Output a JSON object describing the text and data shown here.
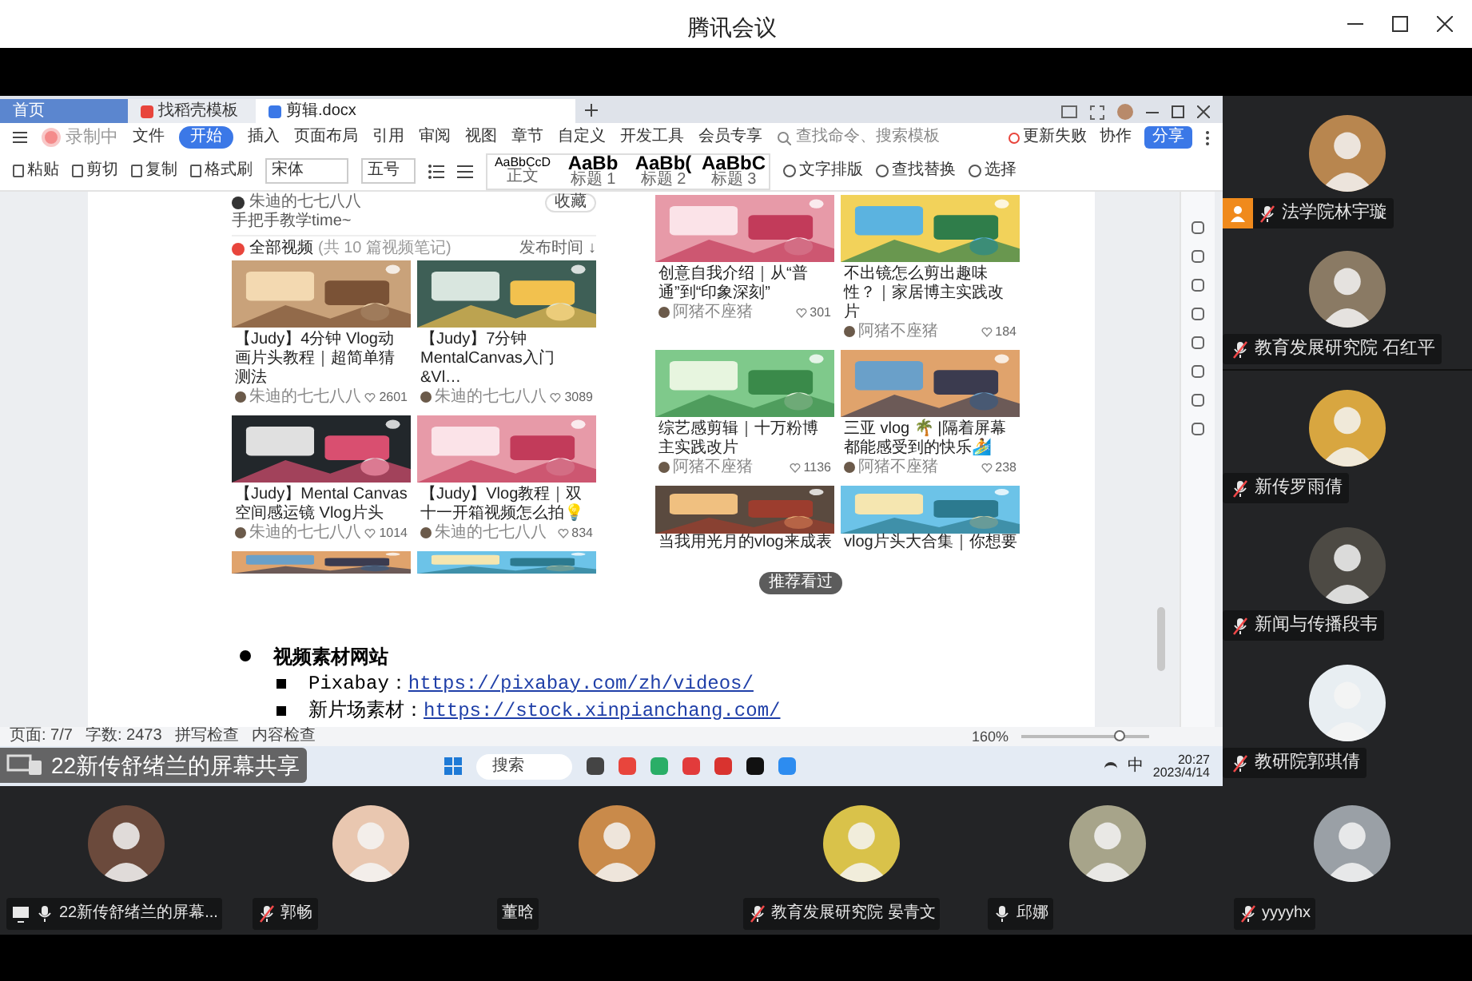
{
  "window": {
    "title": "腾讯会议"
  },
  "recording": {
    "label": "录制中"
  },
  "share": {
    "tabs": [
      {
        "label": "首页",
        "selected": false,
        "kind": "home"
      },
      {
        "label": "找稻壳模板",
        "selected": false,
        "kind": "template"
      },
      {
        "label": "剪辑.docx",
        "selected": true,
        "kind": "doc"
      }
    ],
    "menu": [
      {
        "label": "文件",
        "selected": false
      },
      {
        "label": "开始",
        "selected": true
      },
      {
        "label": "插入",
        "selected": false
      },
      {
        "label": "页面布局",
        "selected": false
      },
      {
        "label": "引用",
        "selected": false
      },
      {
        "label": "审阅",
        "selected": false
      },
      {
        "label": "视图",
        "selected": false
      },
      {
        "label": "章节",
        "selected": false
      },
      {
        "label": "自定义",
        "selected": false
      },
      {
        "label": "开发工具",
        "selected": false
      },
      {
        "label": "会员专享",
        "selected": false
      }
    ],
    "command_search": {
      "placeholder": "查找命令、搜索模板"
    },
    "sync_status": "更新失败",
    "collab": "协作",
    "share_button": "分享",
    "ribbon": {
      "clipboard": [
        "粘贴",
        "剪切",
        "复制",
        "格式刷"
      ],
      "font": "宋体",
      "size": "五号",
      "styles": [
        {
          "sample": "AaBbCcD",
          "label": "正文"
        },
        {
          "sample": "AaBb",
          "label": "标题 1"
        },
        {
          "sample": "AaBb(",
          "label": "标题 2"
        },
        {
          "sample": "AaBbC",
          "label": "标题 3"
        }
      ],
      "tools": [
        "文字排版",
        "查找替换",
        "选择"
      ]
    },
    "document": {
      "author": "朱迪的七七八八",
      "save_button": "收藏",
      "intro": "手把手教学time~",
      "section": {
        "title": "全部视频",
        "count": "(共 10 篇视频笔记)",
        "sort": "发布时间 ↓"
      },
      "left_cards": [
        {
          "title": "【Judy】4分钟 Vlog动画片头教程｜超简单猜测法",
          "author": "朱迪的七七八八",
          "likes": "2601"
        },
        {
          "title": "【Judy】7分钟 MentalCanvas入门&Vl…",
          "author": "朱迪的七七八八",
          "likes": "3089"
        },
        {
          "title": "【Judy】Mental Canvas 空间感运镜 Vlog片头",
          "author": "朱迪的七七八八",
          "likes": "1014"
        },
        {
          "title": "【Judy】Vlog教程｜双十一开箱视频怎么拍💡",
          "author": "朱迪的七七八八",
          "likes": "834"
        }
      ],
      "right_cards": [
        {
          "title": "创意自我介绍｜从“普通”到“印象深刻”",
          "author": "阿猪不座猪",
          "likes": "301"
        },
        {
          "title": "不出镜怎么剪出趣味性？｜家居博主实践改片",
          "author": "阿猪不座猪",
          "likes": "184"
        },
        {
          "title": "综艺感剪辑｜十万粉博主实践改片",
          "author": "阿猪不座猪",
          "likes": "1136"
        },
        {
          "title": "三亚 vlog 🌴 |隔着屏幕都能感受到的快乐🏄",
          "author": "阿猪不座猪",
          "likes": "238"
        }
      ],
      "right_partial": [
        "当我用光月的vlog来成表",
        "vlog片头大合集｜你想要"
      ],
      "recent_pill": "推荐看过",
      "list": [
        {
          "kind": "heading",
          "text": "视频素材网站"
        },
        {
          "kind": "link",
          "label": "Pixabay：",
          "url": "https://pixabay.com/zh/videos/"
        },
        {
          "kind": "link",
          "label": "新片场素材：",
          "url": "https://stock.xinpianchang.com/"
        }
      ]
    },
    "status_bar": {
      "page": "页面: 7/7",
      "words": "字数: 2473",
      "spell": "拼写检查",
      "content": "内容检查",
      "zoom": "160%",
      "zoom_slider": {
        "level": 0.8
      }
    },
    "taskbar": {
      "search": "搜索",
      "ime": "中",
      "time": "20:27",
      "date": "2023/4/14"
    },
    "share_label": "22新传舒绪兰的屏幕共享"
  },
  "side_participants": [
    {
      "name": "法学院林宇璇",
      "muted": true,
      "host": true
    },
    {
      "name": "教育发展研究院 石红平",
      "muted": true,
      "host": false
    },
    {
      "name": "新传罗雨倩",
      "muted": true,
      "host": false
    },
    {
      "name": "新闻与传播段韦",
      "muted": true,
      "host": false
    },
    {
      "name": "教研院郭琪倩",
      "muted": true,
      "host": false
    }
  ],
  "bottom_participants": [
    {
      "name": "22新传舒绪兰的屏幕...",
      "mic_shown": true,
      "muted": false,
      "sharing": true
    },
    {
      "name": "郭畅",
      "mic_shown": true,
      "muted": true,
      "sharing": false
    },
    {
      "name": "董晗",
      "mic_shown": false,
      "sharing": false
    },
    {
      "name": "教育发展研究院 晏青文",
      "mic_shown": true,
      "muted": true,
      "sharing": false
    },
    {
      "name": "邱娜",
      "mic_shown": true,
      "muted": false,
      "sharing": false
    },
    {
      "name": "yyyyhx",
      "mic_shown": true,
      "muted": true,
      "sharing": false
    }
  ]
}
